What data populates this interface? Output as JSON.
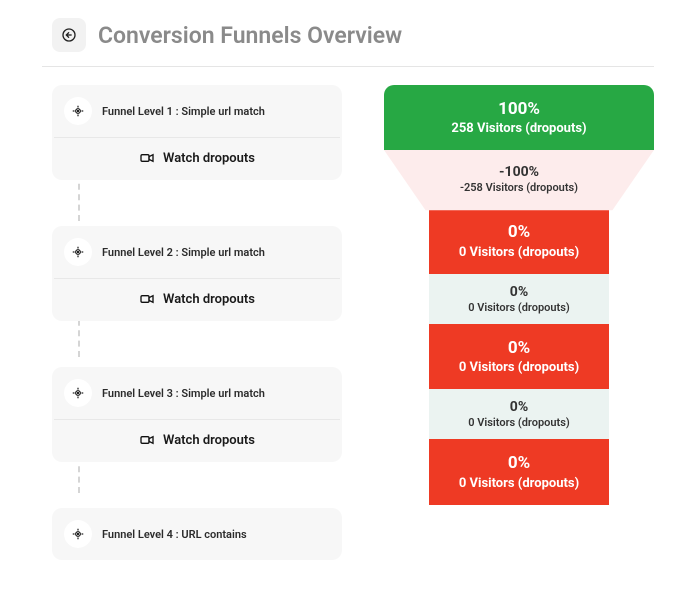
{
  "header": {
    "title": "Conversion Funnels Overview"
  },
  "colors": {
    "green": "#27a844",
    "red": "#ee3a24",
    "gap": "#ebf3f1",
    "trap": "#fdecec"
  },
  "levels": [
    {
      "label": "Funnel Level 1 : Simple url match",
      "action": "Watch dropouts"
    },
    {
      "label": "Funnel Level 2 : Simple url match",
      "action": "Watch dropouts"
    },
    {
      "label": "Funnel Level 3 : Simple url match",
      "action": "Watch dropouts"
    },
    {
      "label": "Funnel Level 4 : URL contains"
    }
  ],
  "funnel": {
    "block1": {
      "pct": "100%",
      "sub": "258 Visitors (dropouts)"
    },
    "drop": {
      "pct": "-100%",
      "sub": "-258 Visitors (dropouts)"
    },
    "block2": {
      "pct": "0%",
      "sub": "0 Visitors (dropouts)"
    },
    "gap2": {
      "pct": "0%",
      "sub": "0 Visitors (dropouts)"
    },
    "block3": {
      "pct": "0%",
      "sub": "0 Visitors (dropouts)"
    },
    "gap3": {
      "pct": "0%",
      "sub": "0 Visitors (dropouts)"
    },
    "block4": {
      "pct": "0%",
      "sub": "0 Visitors (dropouts)"
    }
  }
}
